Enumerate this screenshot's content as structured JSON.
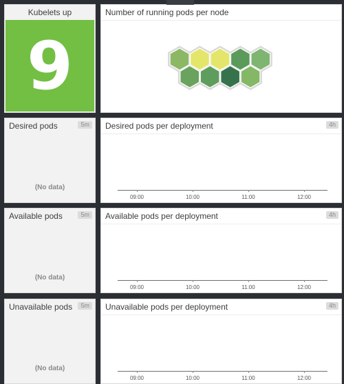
{
  "kubelets": {
    "title": "Kubelets up",
    "value": "9",
    "bg_color": "#72bf44"
  },
  "hexmap": {
    "title": "Number of running pods per node",
    "cells": [
      {
        "color": "#8cb865"
      },
      {
        "color": "#e3e66b"
      },
      {
        "color": "#e3e66b"
      },
      {
        "color": "#5a9a5a"
      },
      {
        "color": "#7eb570"
      },
      {
        "color": "#6aa35e"
      },
      {
        "color": "#5f9d5f"
      },
      {
        "color": "#36734c"
      },
      {
        "color": "#84b866"
      }
    ]
  },
  "rows": [
    {
      "left_title": "Desired pods",
      "left_badge": "5m",
      "no_data": "(No data)",
      "right_title": "Desired pods per deployment",
      "right_badge": "4h"
    },
    {
      "left_title": "Available pods",
      "left_badge": "5m",
      "no_data": "(No data)",
      "right_title": "Available pods per deployment",
      "right_badge": "4h"
    },
    {
      "left_title": "Unavailable pods",
      "left_badge": "5m",
      "no_data": "(No data)",
      "right_title": "Unavailable pods per deployment",
      "right_badge": "4h"
    }
  ],
  "x_ticks": [
    "09:00",
    "10:00",
    "11:00",
    "12:00"
  ]
}
